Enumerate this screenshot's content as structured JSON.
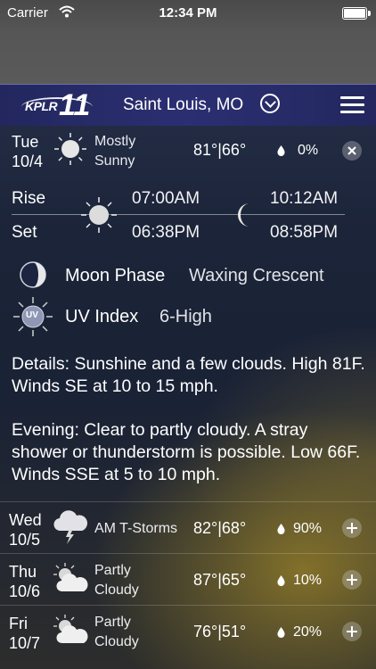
{
  "status_bar": {
    "carrier": "Carrier",
    "time": "12:34 PM",
    "battery_level": 1.0
  },
  "header": {
    "logo_text": "KPLR",
    "logo_number": "11",
    "location": "Saint Louis, MO"
  },
  "today": {
    "day": "Tue",
    "date": "10/4",
    "condition_line1": "Mostly",
    "condition_line2": "Sunny",
    "high": "81°",
    "low": "66°",
    "precip": "0%"
  },
  "sun_moon": {
    "rise_label": "Rise",
    "set_label": "Set",
    "sunrise": "07:00AM",
    "sunset": "06:38PM",
    "moonrise": "10:12AM",
    "moonset": "08:58PM"
  },
  "moon_phase": {
    "label": "Moon Phase",
    "value": "Waxing Crescent"
  },
  "uv_index": {
    "label": "UV Index",
    "value": "6-High",
    "icon_text": "UV"
  },
  "details": {
    "day": "Details: Sunshine and a few clouds. High 81F. Winds SE at 10 to 15 mph.",
    "evening": "Evening: Clear to partly cloudy. A stray shower or thunderstorm is possible. Low 66F. Winds SSE at 5 to 10 mph."
  },
  "forecast": [
    {
      "day": "Wed",
      "date": "10/5",
      "condition_line1": "AM T-Storms",
      "condition_line2": "",
      "high": "82°",
      "low": "68°",
      "precip": "90%",
      "icon": "thunderstorm-icon"
    },
    {
      "day": "Thu",
      "date": "10/6",
      "condition_line1": "Partly",
      "condition_line2": "Cloudy",
      "high": "87°",
      "low": "65°",
      "precip": "10%",
      "icon": "partly-cloudy-icon"
    },
    {
      "day": "Fri",
      "date": "10/7",
      "condition_line1": "Partly",
      "condition_line2": "Cloudy",
      "high": "76°",
      "low": "51°",
      "precip": "20%",
      "icon": "partly-cloudy-icon"
    }
  ],
  "colors": {
    "header_bg": "#2b2f72",
    "accent_gold": "#a08728",
    "text": "#ffffff"
  }
}
